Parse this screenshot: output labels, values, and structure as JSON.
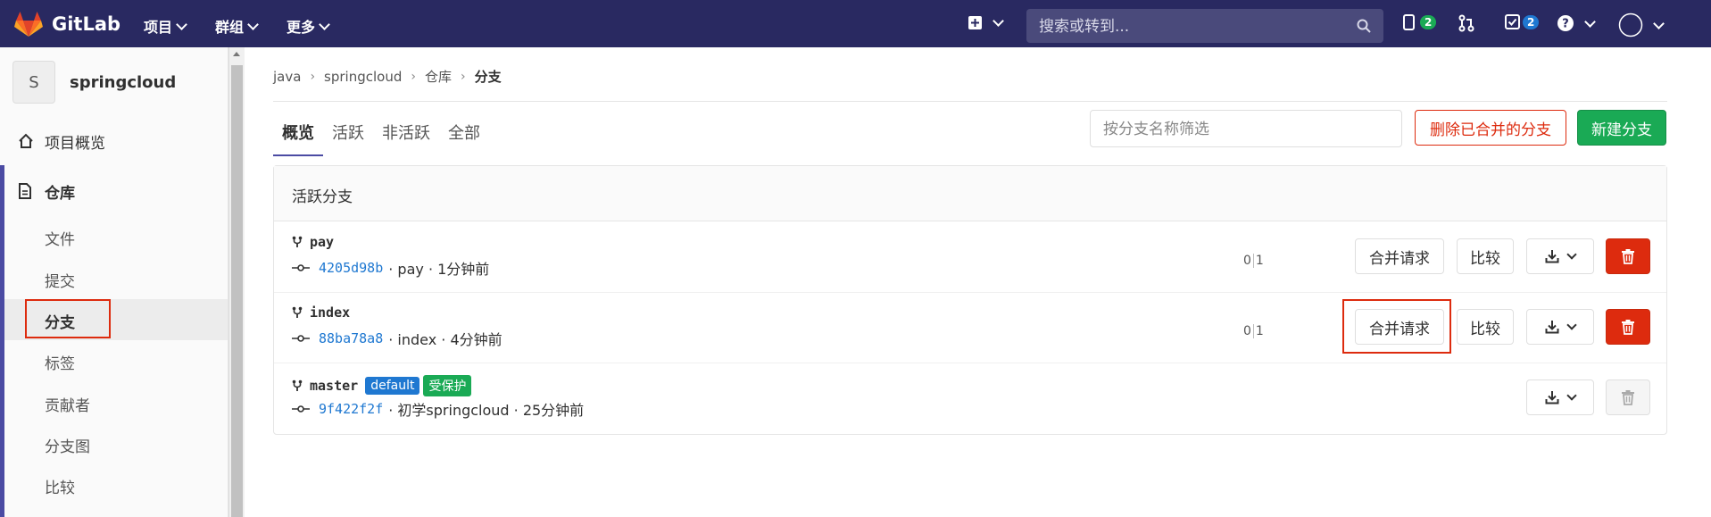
{
  "header": {
    "app_name": "GitLab",
    "nav": [
      {
        "label": "项目"
      },
      {
        "label": "群组"
      },
      {
        "label": "更多"
      }
    ],
    "search_placeholder": "搜索或转到...",
    "issues_count": "2",
    "todos_count": "2",
    "icons": [
      "gitlab-logo-icon",
      "plus-square-icon",
      "search-icon",
      "issues-icon",
      "merge-request-icon",
      "todo-icon",
      "help-icon",
      "user-avatar-icon"
    ]
  },
  "sidebar": {
    "project_initial": "S",
    "project_name": "springcloud",
    "overview_label": "项目概览",
    "repository_label": "仓库",
    "sub_items": [
      "文件",
      "提交",
      "分支",
      "标签",
      "贡献者",
      "分支图",
      "比较"
    ]
  },
  "breadcrumb": {
    "items": [
      "java",
      "springcloud",
      "仓库",
      "分支"
    ]
  },
  "tabs": [
    "概览",
    "活跃",
    "非活跃",
    "全部"
  ],
  "filter_placeholder": "按分支名称筛选",
  "actions": {
    "delete_merged": "删除已合并的分支",
    "new_branch": "新建分支"
  },
  "panel": {
    "title": "活跃分支",
    "branches": [
      {
        "name": "pay",
        "sha": "4205d98b",
        "message": "· pay · 1分钟前",
        "behind": "0",
        "ahead": "1",
        "merge_label": "合并请求",
        "compare_label": "比较"
      },
      {
        "name": "index",
        "sha": "88ba78a8",
        "message": "· index · 4分钟前",
        "behind": "0",
        "ahead": "1",
        "merge_label": "合并请求",
        "compare_label": "比较"
      },
      {
        "name": "master",
        "sha": "9f422f2f",
        "message": "· 初学springcloud · 25分钟前",
        "badge_default": "default",
        "badge_protected": "受保护"
      }
    ]
  },
  "colors": {
    "header_bg": "#292961",
    "accent": "#4b4ba3",
    "success": "#1aaa55",
    "danger": "#dd2b0e",
    "link": "#1f78d1"
  }
}
